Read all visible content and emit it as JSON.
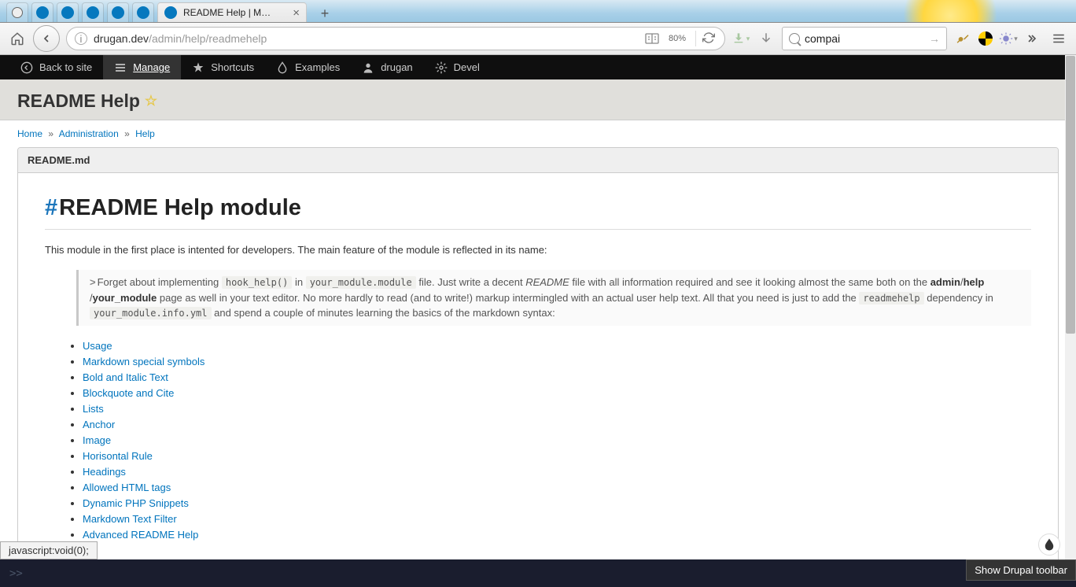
{
  "browser": {
    "tab_title": "README Help | M…",
    "url_prefix": "drugan.dev",
    "url_path": "/admin/help/readmehelp",
    "zoom": "80%",
    "search_value": "compai"
  },
  "toolbar": {
    "back": "Back to site",
    "manage": "Manage",
    "shortcuts": "Shortcuts",
    "examples": "Examples",
    "user": "drugan",
    "devel": "Devel"
  },
  "page": {
    "title": "README Help"
  },
  "breadcrumb": {
    "home": "Home",
    "admin": "Administration",
    "help": "Help"
  },
  "tab_label": "README.md",
  "readme": {
    "heading": "README Help module",
    "intro": "This module in the first place is intented for developers. The main feature of the module is reflected in its name:",
    "quote_text1": "Forget about implementing ",
    "quote_code1": "hook_help()",
    "quote_text2": " in ",
    "quote_code2": "your_module.module",
    "quote_text3": " file. Just write a decent ",
    "quote_em": "README",
    "quote_text4": " file with all information required and see it looking almost the same both on the ",
    "quote_bold1": "admin",
    "quote_slash": "/",
    "quote_bold2": "help",
    "quote_text5": " /",
    "quote_bold3": "your_module",
    "quote_text6": " page as well in your text editor. No more hardly to read (and to write!) markup intermingled with an actual user help text. All that you need is just to add the ",
    "quote_code3": "readmehelp",
    "quote_text7": " dependency in ",
    "quote_code4": "your_module.info.yml",
    "quote_text8": " and spend a couple of minutes learning the basics of the markdown syntax:"
  },
  "toc": [
    "Usage",
    "Markdown special symbols",
    "Bold and Italic Text",
    "Blockquote and Cite",
    "Lists",
    "Anchor",
    "Image",
    "Horisontal Rule",
    "Headings",
    "Allowed HTML tags",
    "Dynamic PHP Snippets",
    "Markdown Text Filter",
    "Advanced README Help"
  ],
  "status_bar": "javascript:void(0);",
  "bottom": {
    "prompt": ">>",
    "tooltip": "Show Drupal toolbar"
  }
}
